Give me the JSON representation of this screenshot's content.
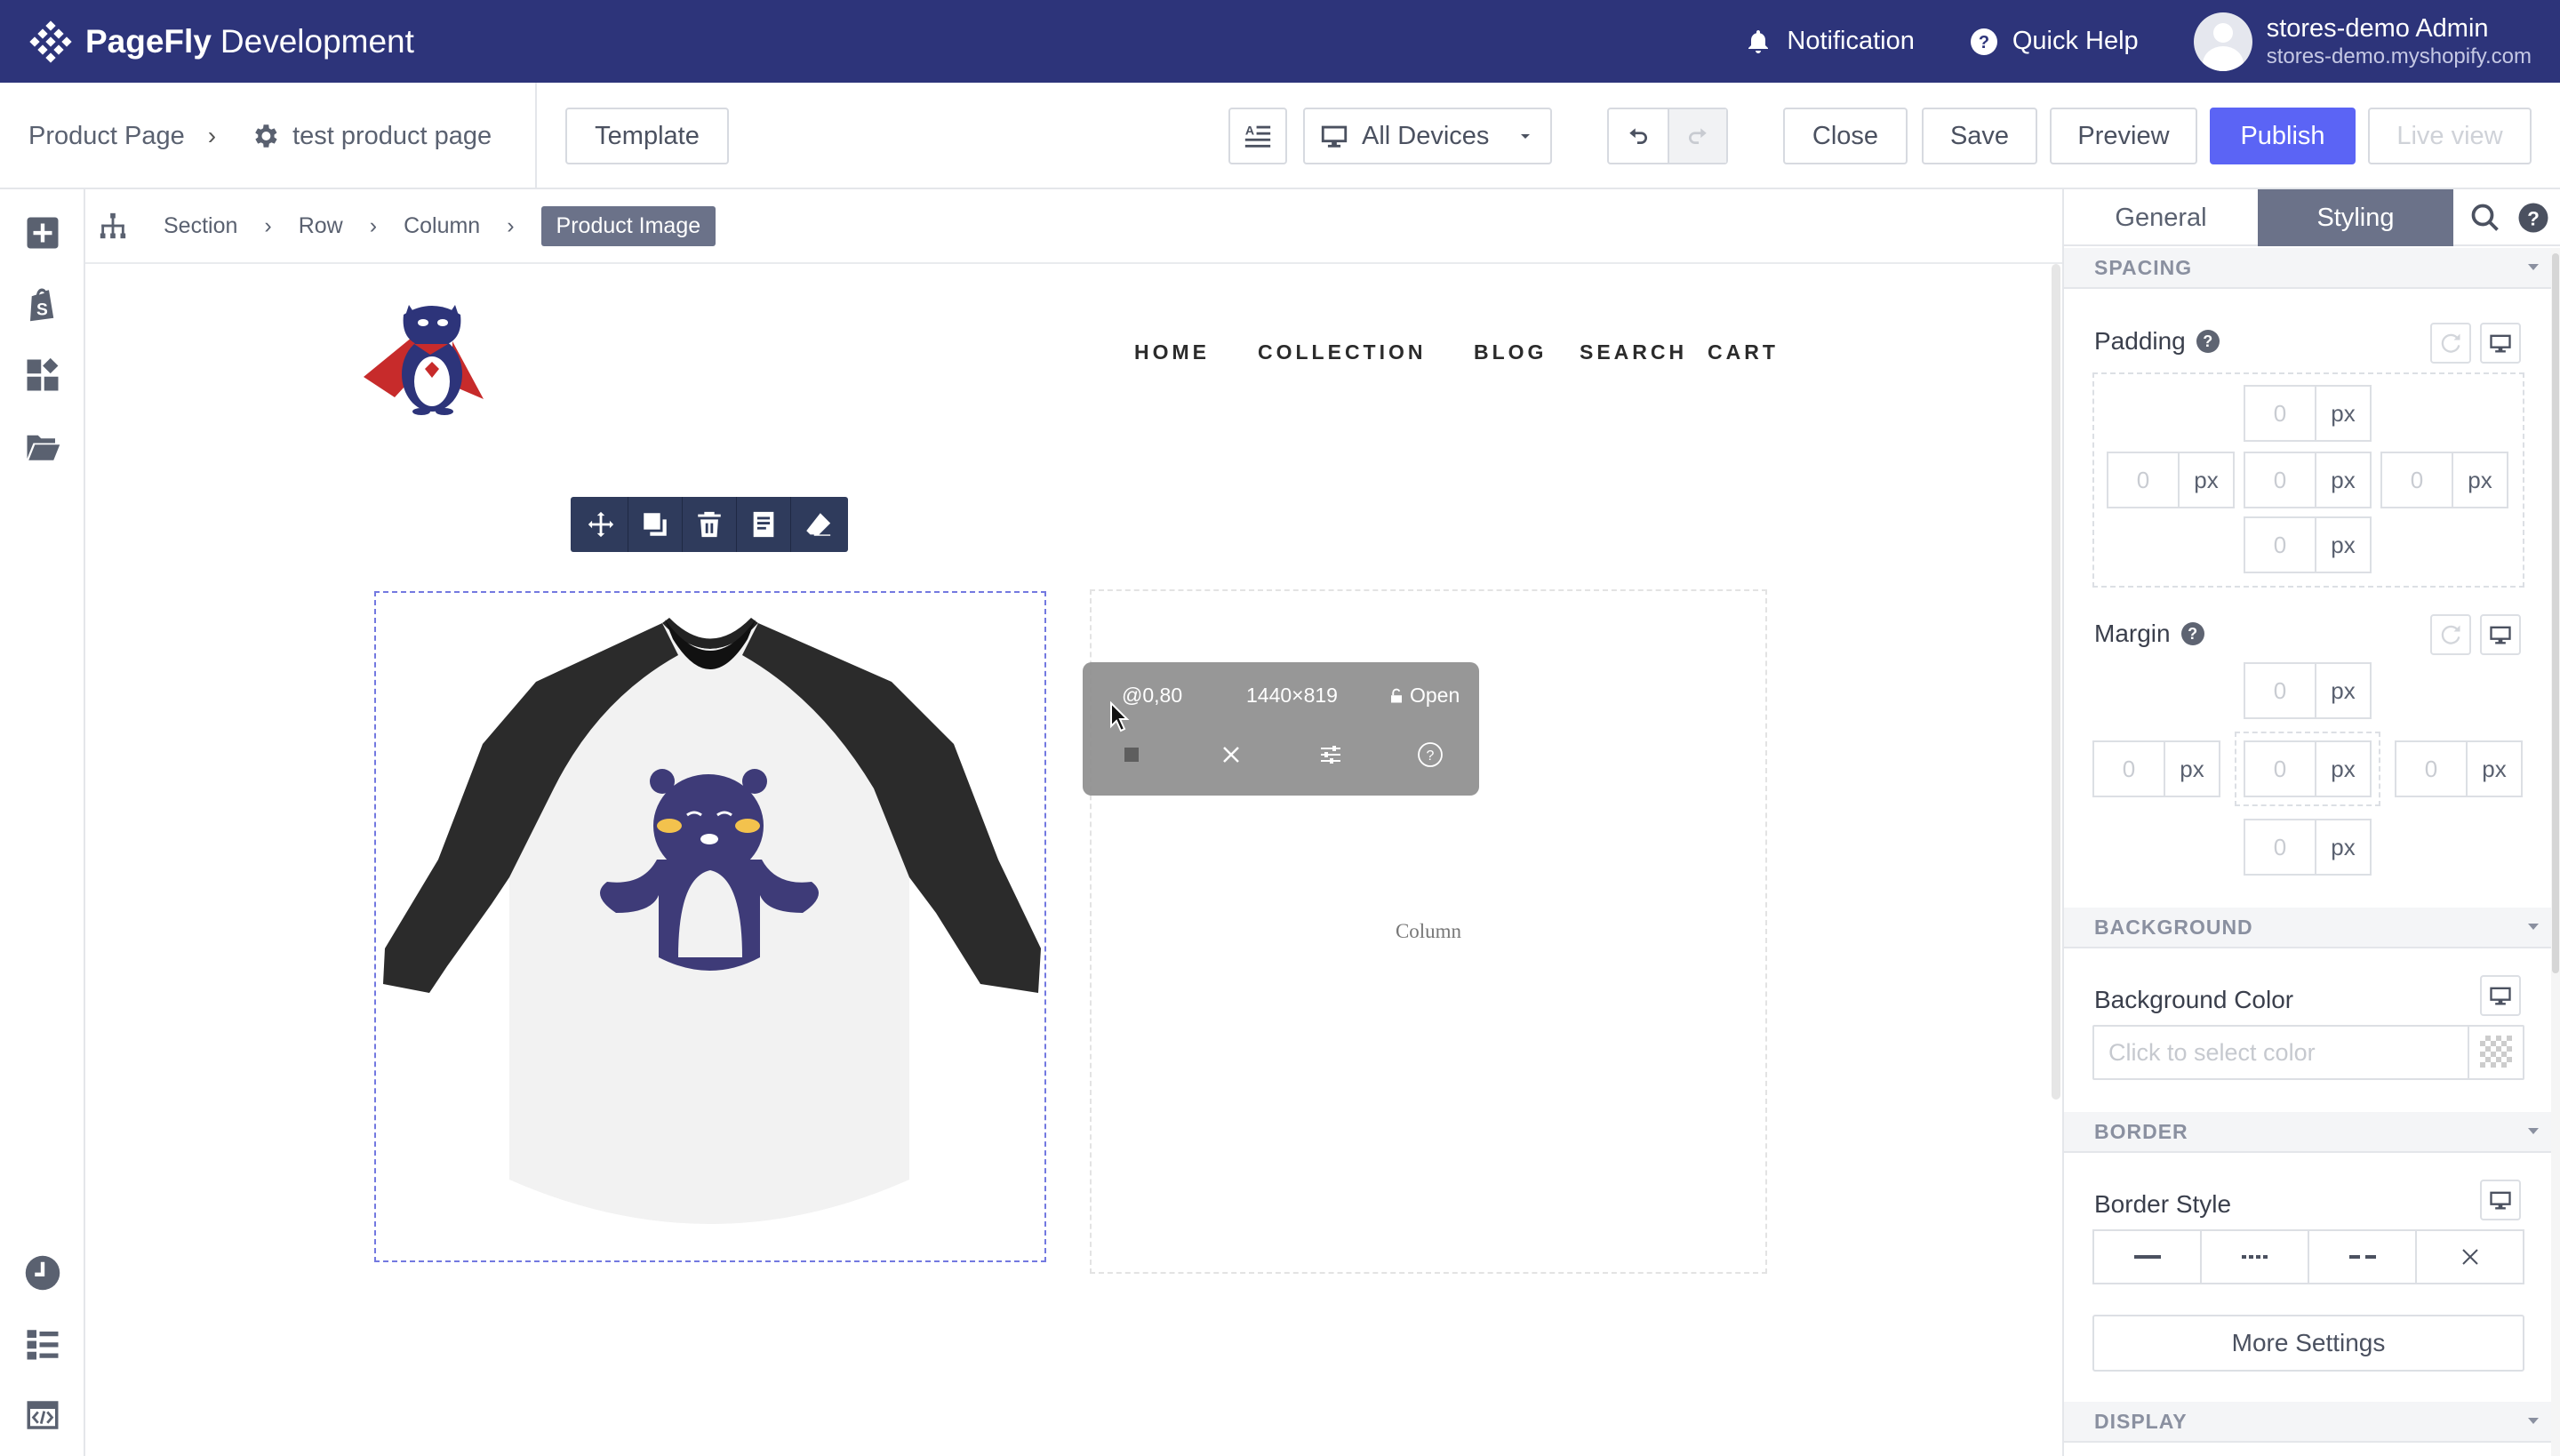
{
  "app": {
    "brand_bold": "PageFly",
    "brand_light": "Development",
    "notification": "Notification",
    "quick_help": "Quick Help",
    "user_name": "stores-demo Admin",
    "user_store": "stores-demo.myshopify.com"
  },
  "toolbar": {
    "page_type": "Product Page",
    "page_name": "test product page",
    "template": "Template",
    "devices": "All Devices",
    "close": "Close",
    "save": "Save",
    "preview": "Preview",
    "publish": "Publish",
    "live_view": "Live view"
  },
  "breadcrumb": [
    "Section",
    "Row",
    "Column",
    "Product Image"
  ],
  "canvas": {
    "nav": [
      "HOME",
      "COLLECTION",
      "BLOG",
      "SEARCH",
      "CART"
    ],
    "column_label": "Column",
    "popup": {
      "scale": "@0,80",
      "size": "1440×819",
      "lock": "Open"
    }
  },
  "panel": {
    "tabs": [
      "General",
      "Styling"
    ],
    "spacing": "SPACING",
    "padding": "Padding",
    "padding_values": {
      "top": "0",
      "left": "0",
      "center": "0",
      "right": "0",
      "bottom": "0"
    },
    "margin": "Margin",
    "margin_values": {
      "top": "0",
      "left": "0",
      "center": "0",
      "right": "0",
      "bottom": "0"
    },
    "unit": "px",
    "background": "BACKGROUND",
    "background_color": "Background Color",
    "color_placeholder": "Click to select color",
    "border": "BORDER",
    "border_style": "Border Style",
    "more_settings": "More Settings",
    "display": "DISPLAY"
  },
  "colors": {
    "topbar": "#2d347a",
    "primary": "#5b64f5",
    "active_tab": "#6b7289",
    "selection": "#7379e0"
  }
}
